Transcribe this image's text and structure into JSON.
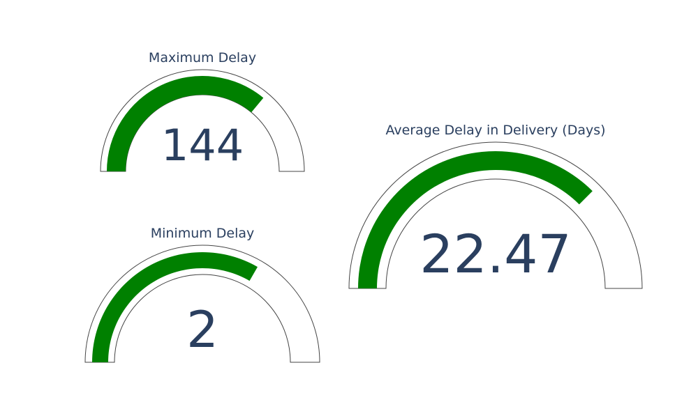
{
  "colors": {
    "bar": "#008000",
    "text": "#2a3f5f",
    "frame": "#444444",
    "background": "#ffffff"
  },
  "chart_data": [
    {
      "type": "gauge",
      "id": "maximum-delay",
      "title": "Maximum Delay",
      "value": 144,
      "value_label": "144",
      "range": [
        0,
        200
      ]
    },
    {
      "type": "gauge",
      "id": "minimum-delay",
      "title": "Minimum Delay",
      "value": 2,
      "value_label": "2",
      "range": [
        0,
        3
      ]
    },
    {
      "type": "gauge",
      "id": "average-delay",
      "title": "Average Delay in Delivery (Days)",
      "value": 22.47,
      "value_label": "22.47",
      "range": [
        0,
        30
      ]
    }
  ]
}
